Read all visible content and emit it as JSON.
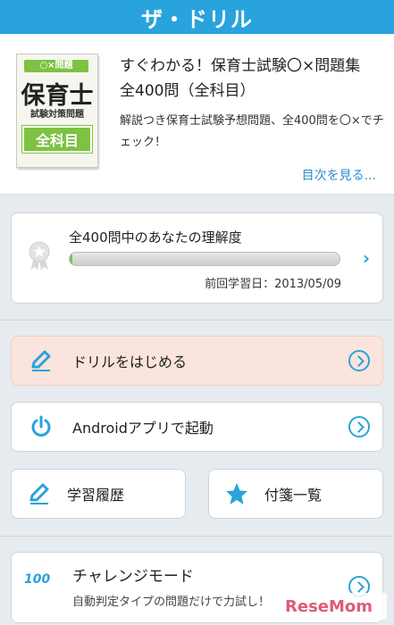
{
  "header": {
    "title": "ザ・ドリル"
  },
  "book": {
    "cover": {
      "tag": "○×問題",
      "main": "保育士",
      "sub": "試験対策問題",
      "band": "全科目"
    },
    "title": "すぐわかる！保育士試験〇×問題集　全400問（全科目）",
    "description": "解説つき保育士試験予想問題、全400問を〇×でチェック！",
    "toc_link": "目次を見る..."
  },
  "progress": {
    "label": "全400問中のあなたの理解度",
    "fraction": 0.01,
    "last_date": "前回学習日：2013/05/09"
  },
  "actions": {
    "start_drill": "ドリルをはじめる",
    "android_app": "Androidアプリで起動",
    "history": "学習履歴",
    "bookmarks": "付箋一覧"
  },
  "challenge": {
    "title": "チャレンジモード",
    "description": "自動判定タイプの問題だけで力試し！",
    "icon_text": "100"
  },
  "watermark": "ReseMom",
  "colors": {
    "accent": "#29a3dc",
    "green": "#7dc242",
    "pink": "#fbe4dd"
  }
}
